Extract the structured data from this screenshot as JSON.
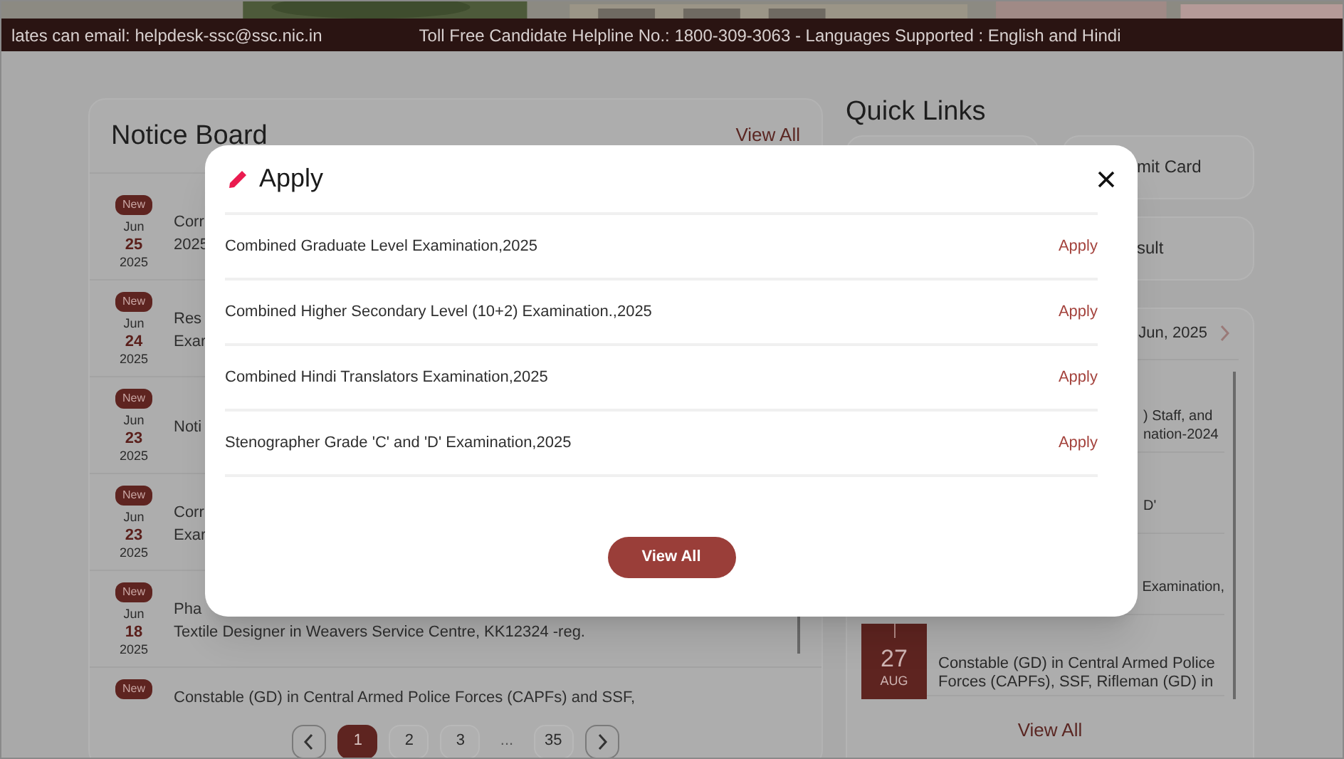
{
  "top_bar": {
    "email_text": "lates can email: helpdesk-ssc@ssc.nic.in",
    "helpline_text": "Toll Free Candidate Helpline No.: 1800-309-3063 - Languages Supported : English and Hindi"
  },
  "notice_board": {
    "title": "Notice Board",
    "view_all": "View All",
    "items": [
      {
        "badge": "New",
        "month": "Jun",
        "day": "25",
        "year": "2025",
        "lines": [
          "Corr",
          "2025"
        ]
      },
      {
        "badge": "New",
        "month": "Jun",
        "day": "24",
        "year": "2025",
        "lines": [
          "Res",
          "Exar"
        ]
      },
      {
        "badge": "New",
        "month": "Jun",
        "day": "23",
        "year": "2025",
        "lines": [
          "Noti"
        ]
      },
      {
        "badge": "New",
        "month": "Jun",
        "day": "23",
        "year": "2025",
        "lines": [
          "Corr",
          "Exar"
        ]
      },
      {
        "badge": "New",
        "month": "Jun",
        "day": "18",
        "year": "2025",
        "lines": [
          "Pha",
          "Textile Designer in Weavers Service Centre, KK12324 -reg."
        ]
      },
      {
        "badge": "New",
        "lines": [
          "Constable (GD) in Central Armed Police Forces (CAPFs) and SSF,"
        ]
      }
    ],
    "pagination": [
      {
        "label": "1",
        "selected": true
      },
      {
        "label": "2",
        "selected": false
      },
      {
        "label": "3",
        "selected": false
      },
      {
        "label": "...",
        "kind": "gap",
        "selected": false
      },
      {
        "label": "35",
        "selected": false
      }
    ]
  },
  "quick_links": {
    "title": "Quick Links",
    "cards": [
      {
        "label": "mit Card"
      },
      {
        "label": "sult"
      }
    ]
  },
  "calendar": {
    "month": "Jun, 2025",
    "events": [
      {
        "lines": [
          ") Staff, and",
          "nation-2024"
        ]
      },
      {
        "lines": [
          "D'"
        ]
      },
      {
        "lines": [
          "Examination,"
        ]
      },
      {
        "day": "27",
        "month": "AUG",
        "lines": [
          "Constable (GD) in Central Armed Police Forces (CAPFs), SSF, Rifleman (GD) in"
        ]
      }
    ],
    "view_all": "View All"
  },
  "modal": {
    "title": "Apply",
    "rows": [
      {
        "name": "Combined Graduate Level Examination,2025",
        "action": "Apply"
      },
      {
        "name": "Combined Higher Secondary Level (10+2) Examination.,2025",
        "action": "Apply"
      },
      {
        "name": "Combined Hindi Translators Examination,2025",
        "action": "Apply"
      },
      {
        "name": "Stenographer Grade 'C' and 'D' Examination,2025",
        "action": "Apply"
      }
    ],
    "button": "View All"
  }
}
